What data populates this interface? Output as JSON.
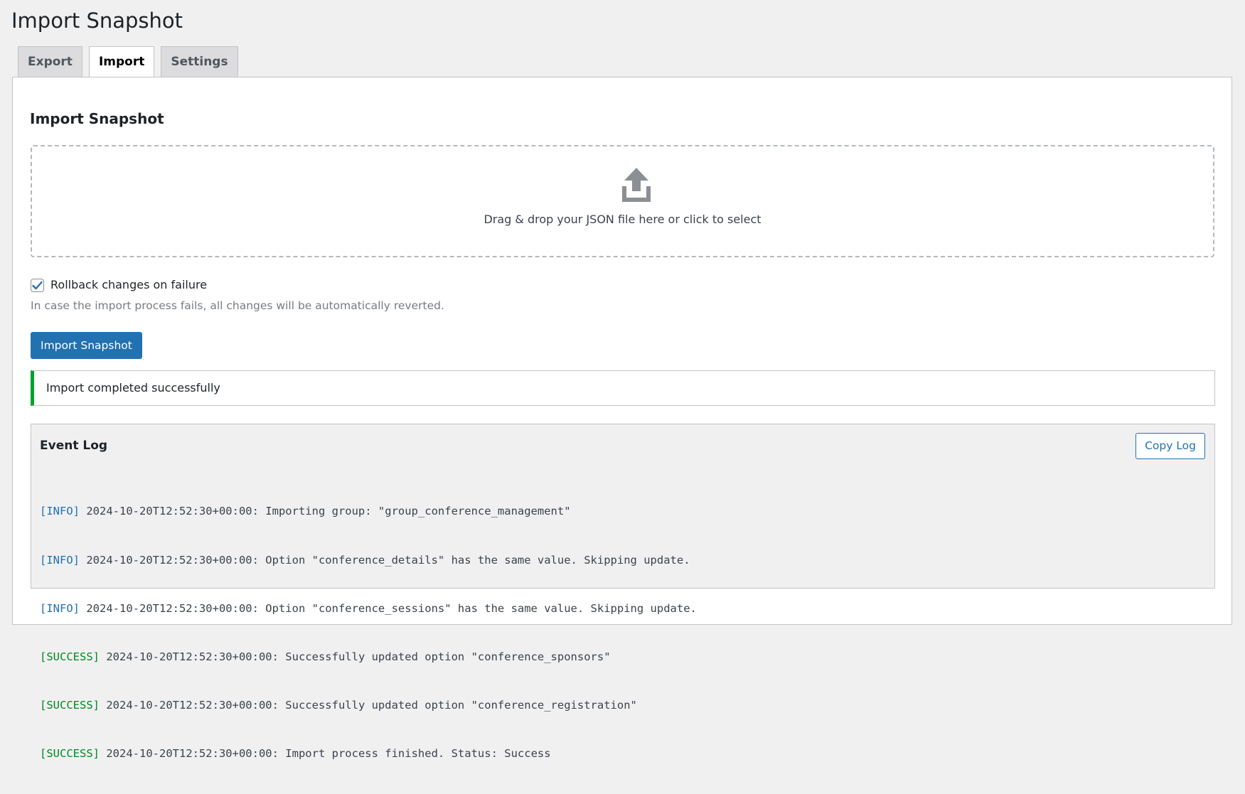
{
  "page": {
    "title": "Import Snapshot"
  },
  "tabs": [
    {
      "label": "Export",
      "active": false
    },
    {
      "label": "Import",
      "active": true
    },
    {
      "label": "Settings",
      "active": false
    }
  ],
  "import_section": {
    "title": "Import Snapshot",
    "dropzone": {
      "icon": "upload-icon",
      "text": "Drag & drop your JSON file here or click to select"
    },
    "rollback": {
      "checked": true,
      "label": "Rollback changes on failure",
      "help": "In case the import process fails, all changes will be automatically reverted."
    },
    "import_button": "Import Snapshot"
  },
  "notice": {
    "text": "Import completed successfully",
    "status": "success"
  },
  "event_log": {
    "title": "Event Log",
    "copy_button": "Copy Log",
    "lines": [
      {
        "level": "[INFO]",
        "message": " 2024-10-20T12:52:30+00:00: Importing group: \"group_conference_management\""
      },
      {
        "level": "[INFO]",
        "message": " 2024-10-20T12:52:30+00:00: Option \"conference_details\" has the same value. Skipping update."
      },
      {
        "level": "[INFO]",
        "message": " 2024-10-20T12:52:30+00:00: Option \"conference_sessions\" has the same value. Skipping update."
      },
      {
        "level": "[SUCCESS]",
        "message": " 2024-10-20T12:52:30+00:00: Successfully updated option \"conference_sponsors\""
      },
      {
        "level": "[SUCCESS]",
        "message": " 2024-10-20T12:52:30+00:00: Successfully updated option \"conference_registration\""
      },
      {
        "level": "[SUCCESS]",
        "message": " 2024-10-20T12:52:30+00:00: Import process finished. Status: Success"
      }
    ]
  },
  "colors": {
    "primary": "#2271b1",
    "success": "#00a32a",
    "info_text": "#2271b1",
    "success_text": "#008a20",
    "background": "#f0f0f1"
  }
}
